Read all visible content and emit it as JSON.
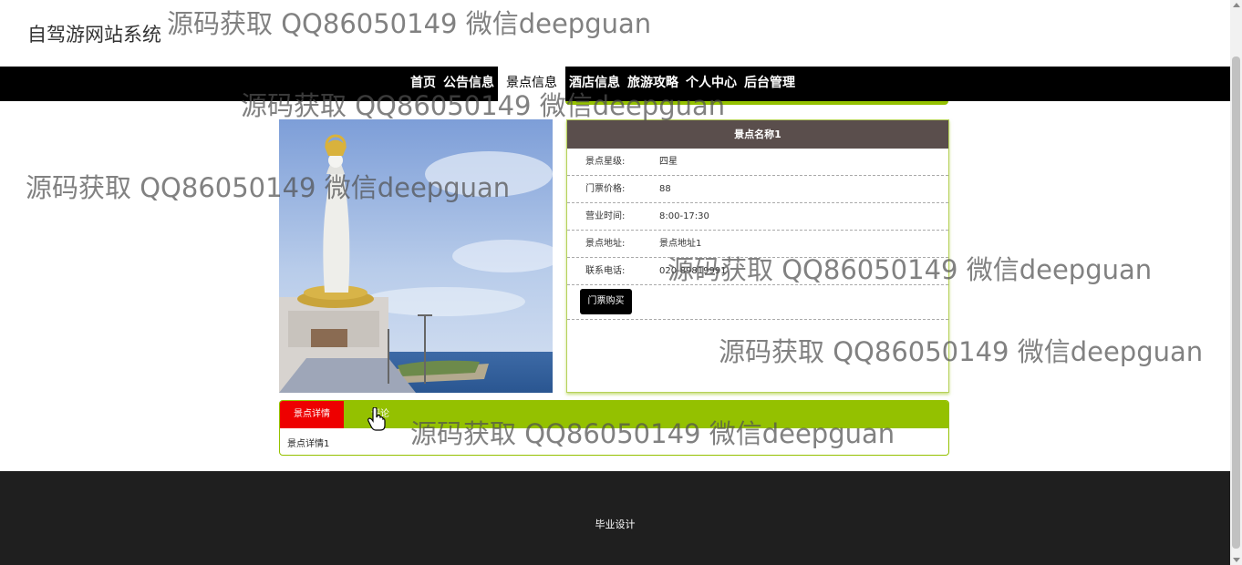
{
  "site": {
    "title": "自驾游网站系统"
  },
  "watermark": {
    "text": "源码获取 QQ86050149 微信deepguan"
  },
  "nav": {
    "items": [
      {
        "label": "首页",
        "active": false
      },
      {
        "label": "公告信息",
        "active": false
      },
      {
        "label": "景点信息",
        "active": true
      },
      {
        "label": "酒店信息",
        "active": false
      },
      {
        "label": "旅游攻略",
        "active": false
      },
      {
        "label": "个人中心",
        "active": false
      },
      {
        "label": "后台管理",
        "active": false
      }
    ]
  },
  "spot": {
    "name": "景点名称1",
    "fields": [
      {
        "label": "景点星级:",
        "value": "四星"
      },
      {
        "label": "门票价格:",
        "value": "88"
      },
      {
        "label": "营业时间:",
        "value": "8:00-17:30"
      },
      {
        "label": "景点地址:",
        "value": "景点地址1"
      },
      {
        "label": "联系电话:",
        "value": "020-89819991"
      }
    ],
    "buy_label": "门票购买"
  },
  "tabs": {
    "items": [
      {
        "label": "景点详情",
        "active": true
      },
      {
        "label": "评论",
        "active": false
      }
    ],
    "content": "景点详情1"
  },
  "footer": {
    "text": "毕业设计"
  },
  "colors": {
    "nav_bg": "#000000",
    "accent_green": "#94c100",
    "tab_active": "#ee0000",
    "title_bar": "#5a4e4c",
    "footer_bg": "#1f1f1f"
  }
}
